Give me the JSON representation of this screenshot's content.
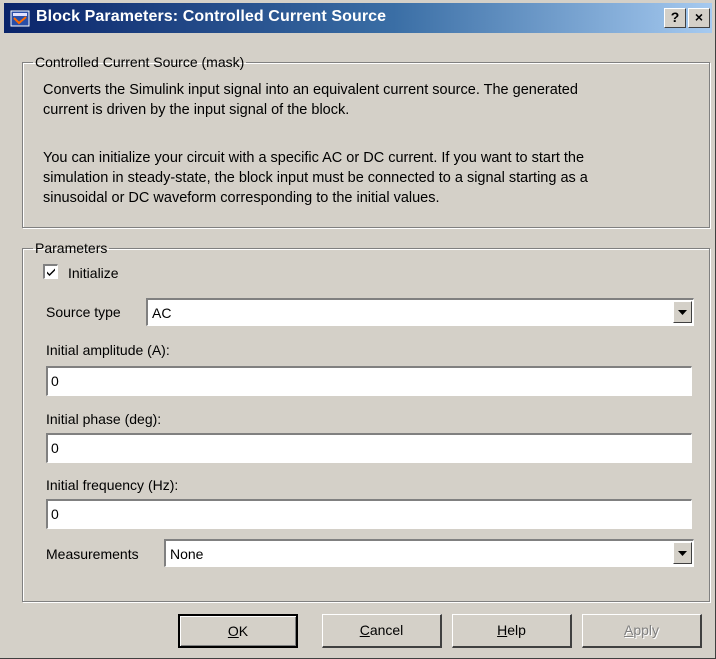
{
  "window": {
    "title": "Block Parameters: Controlled Current Source",
    "help_label": "?",
    "close_label": "×"
  },
  "mask": {
    "legend": "Controlled Current Source (mask)",
    "description_1": [
      "Converts the Simulink input signal into an equivalent current source. The generated",
      "current is driven by the input signal of the block."
    ],
    "description_2": [
      "You can initialize your circuit with a specific AC or DC current. If you want to start the",
      "simulation in steady-state, the block input must be connected to a signal starting as a",
      "sinusoidal or DC waveform corresponding to the initial values."
    ]
  },
  "params": {
    "legend": "Parameters",
    "initialize": {
      "label": "Initialize",
      "checked": true
    },
    "source_type": {
      "label": "Source type",
      "value": "AC"
    },
    "amplitude": {
      "label": "Initial amplitude (A):",
      "value": "0"
    },
    "phase": {
      "label": "Initial phase (deg):",
      "value": "0"
    },
    "frequency": {
      "label": "Initial frequency (Hz):",
      "value": "0"
    },
    "measurements": {
      "label": "Measurements",
      "value": "None"
    }
  },
  "buttons": {
    "ok": {
      "mnemonic": "O",
      "rest": "K"
    },
    "cancel": {
      "mnemonic": "C",
      "rest": "ancel"
    },
    "help": {
      "mnemonic": "H",
      "rest": "elp"
    },
    "apply": {
      "mnemonic": "A",
      "rest": "pply",
      "enabled": false
    }
  },
  "colors": {
    "face": "#d4d0c8",
    "title_start": "#0a246a",
    "title_end": "#a6caf0"
  }
}
